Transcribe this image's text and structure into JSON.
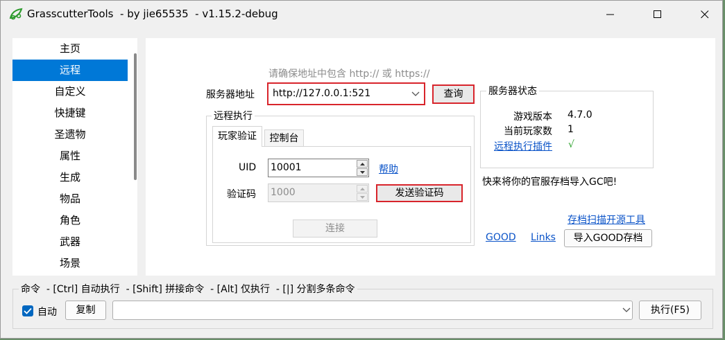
{
  "window": {
    "title": "GrasscutterTools  - by jie65535  - v1.15.2-debug"
  },
  "sidebar": {
    "items": [
      "主页",
      "远程",
      "自定义",
      "快捷键",
      "圣遗物",
      "属性",
      "生成",
      "物品",
      "角色",
      "武器",
      "场景"
    ],
    "selected": "远程"
  },
  "remote": {
    "hint": "请确保地址中包含 http:// 或 https://",
    "server_label": "服务器地址",
    "server_value": "http://127.0.0.1:521",
    "query_label": "查询",
    "exec_group_title": "远程执行",
    "tabs": [
      "玩家验证",
      "控制台"
    ],
    "uid_label": "UID",
    "uid_value": "10001",
    "help_label": "帮助",
    "code_label": "验证码",
    "code_value": "1000",
    "send_code_label": "发送验证码",
    "connect_label": "连接"
  },
  "status": {
    "group_title": "服务器状态",
    "version_label": "游戏版本",
    "version_value": "4.7.0",
    "players_label": "当前玩家数",
    "players_value": "1",
    "plugin_label": "远程执行插件",
    "plugin_value": "√"
  },
  "import": {
    "hint": "快来将你的官服存档导入GC吧!",
    "scan_link": "存档扫描开源工具",
    "good_link": "GOOD",
    "links_link": "Links",
    "import_button": "导入GOOD存档"
  },
  "command": {
    "group_title": "命令  - [Ctrl] 自动执行  - [Shift] 拼接命令  - [Alt] 仅执行  - [|] 分割多条命令",
    "auto_label": "自动",
    "auto_checked": true,
    "copy_label": "复制",
    "input_value": "",
    "execute_label": "执行(F5)"
  },
  "colors": {
    "accent": "#0078d7",
    "highlight_border": "#d8242b",
    "link": "#0a53c8",
    "ok": "#2aa12a"
  },
  "icons": {
    "app": "grasscutter-icon",
    "minimize": "minimize-icon",
    "maximize": "maximize-icon",
    "close": "close-icon"
  }
}
